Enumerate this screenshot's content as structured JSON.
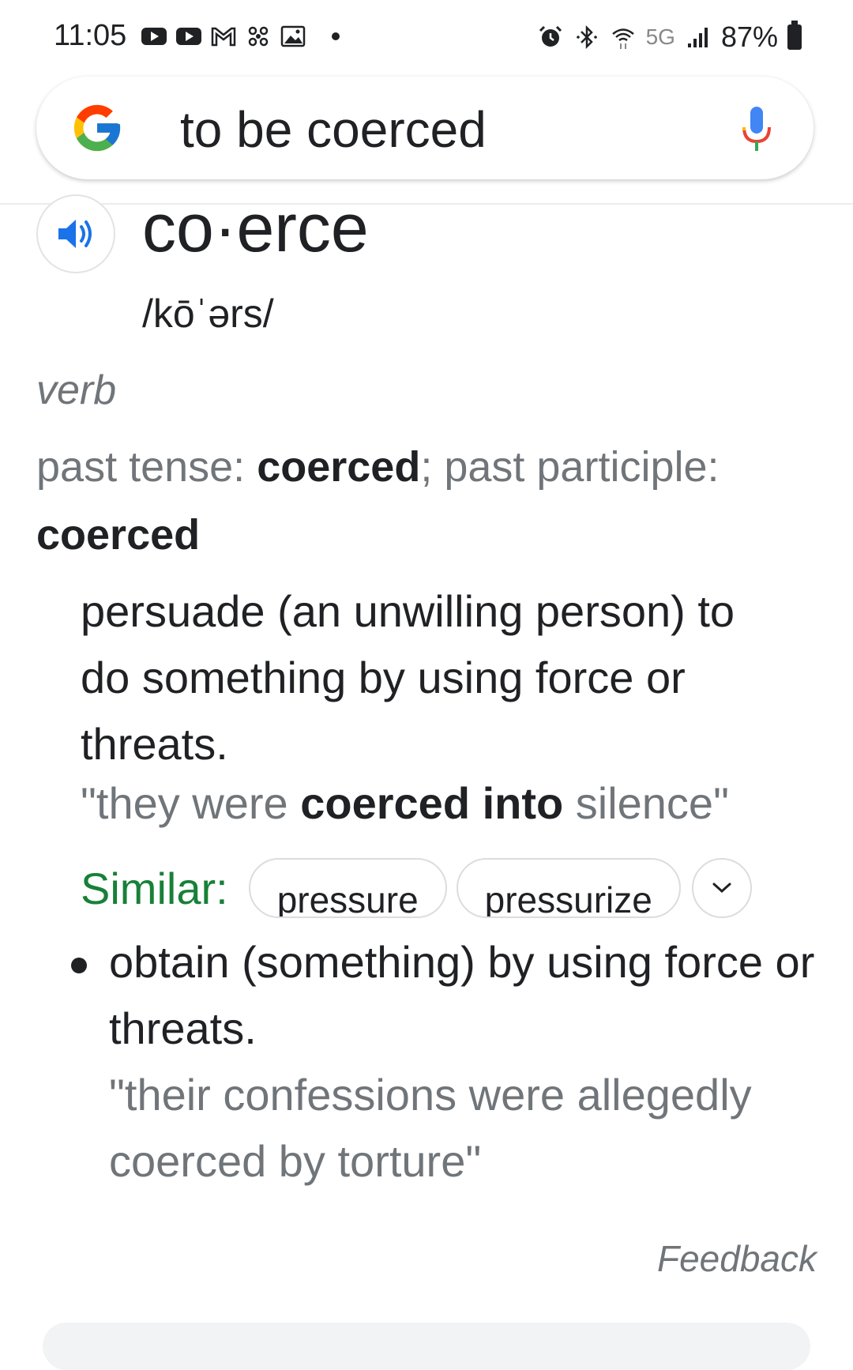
{
  "status_bar": {
    "time": "11:05",
    "network": "5G",
    "battery": "87%",
    "left_icons": [
      "youtube-icon",
      "youtube-icon",
      "gmail-icon",
      "pinwheel-icon",
      "gallery-icon"
    ],
    "right_icons": [
      "alarm-icon",
      "bluetooth-icon",
      "wifi-icon",
      "signal-icon",
      "battery-icon"
    ]
  },
  "search": {
    "query": "to be coerced"
  },
  "entry": {
    "headword": "co·erce",
    "phonetic": "/kōˈərs/",
    "part_of_speech": "verb",
    "tense_label_1": "past tense: ",
    "tense_value_1": "coerced",
    "tense_sep": "; ",
    "tense_label_2": "past participle: ",
    "tense_value_2": "coerced"
  },
  "senses": [
    {
      "definition": "persuade (an unwilling person) to do something by using force or threats.",
      "example_prefix": "\"they were ",
      "example_bold": "coerced into",
      "example_suffix": " silence\"",
      "similar_label": "Similar:",
      "similar": [
        "pressure",
        "pressurize"
      ]
    },
    {
      "definition": "obtain (something) by using force or threats.",
      "example": "\"their confessions were allegedly coerced by torture\""
    }
  ],
  "footer": {
    "feedback": "Feedback"
  },
  "colors": {
    "similar_green": "#188038",
    "secondary_text": "#70757a",
    "speaker_blue": "#1a73e8"
  }
}
